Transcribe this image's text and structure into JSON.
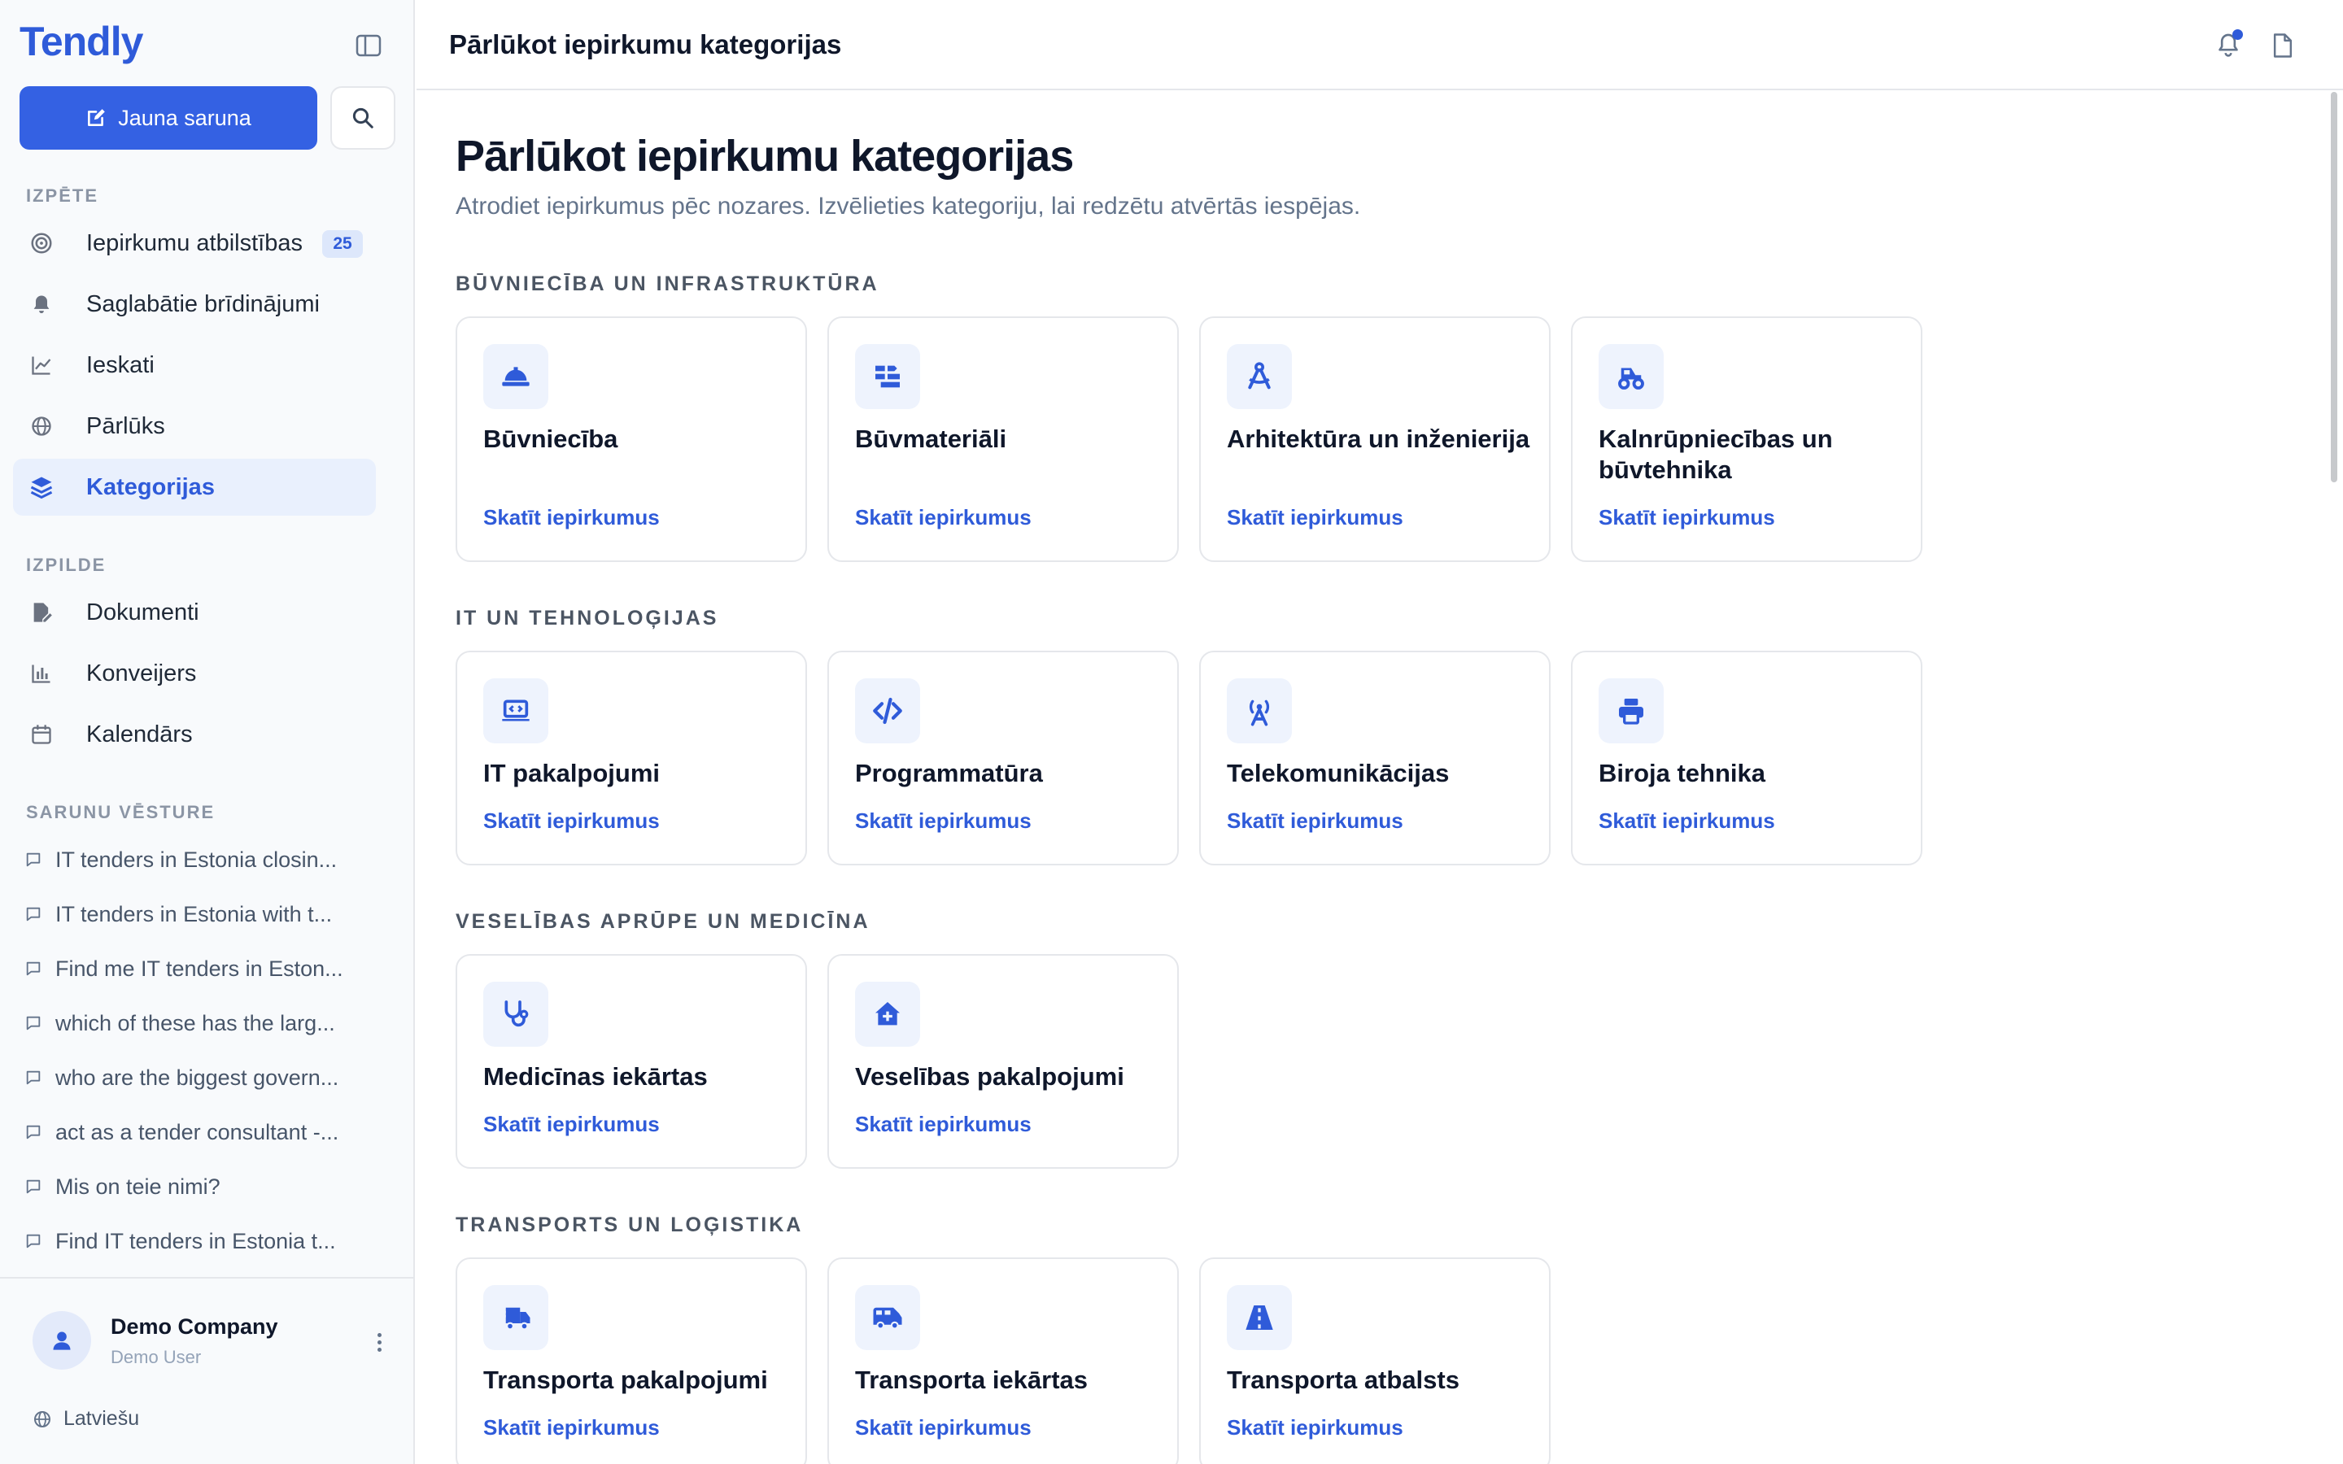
{
  "app": {
    "logo": "Tendly",
    "new_chat_label": "Jauna saruna"
  },
  "sidebar": {
    "section_explore": "IZPĒTE",
    "explore_items": [
      {
        "label": "Iepirkumu atbilstības",
        "icon": "target-icon",
        "badge": "25"
      },
      {
        "label": "Saglabātie brīdinājumi",
        "icon": "bell-icon"
      },
      {
        "label": "Ieskati",
        "icon": "line-chart-icon"
      },
      {
        "label": "Pārlūks",
        "icon": "globe-icon"
      },
      {
        "label": "Kategorijas",
        "icon": "layers-icon",
        "active": true
      }
    ],
    "section_execution": "IZPILDE",
    "execution_items": [
      {
        "label": "Dokumenti",
        "icon": "document-edit-icon"
      },
      {
        "label": "Konveijers",
        "icon": "bar-chart-icon"
      },
      {
        "label": "Kalendārs",
        "icon": "calendar-icon"
      }
    ],
    "section_history": "SARUNU VĒSTURE",
    "history": [
      "IT tenders in Estonia closin...",
      "IT tenders in Estonia with t...",
      "Find me IT tenders in Eston...",
      "which of these has the larg...",
      "who are the biggest govern...",
      "act as a tender consultant -...",
      "Mis on teie nimi?",
      "Find IT tenders in Estonia t..."
    ],
    "user": {
      "name": "Demo Company",
      "role": "Demo User"
    },
    "language": "Latviešu"
  },
  "topbar": {
    "title": "Pārlūkot iepirkumu kategorijas",
    "notification_dot": true
  },
  "main": {
    "title": "Pārlūkot iepirkumu kategorijas",
    "subtitle": "Atrodiet iepirkumus pēc nozares. Izvēlieties kategoriju, lai redzētu atvērtās iespējas.",
    "link_label": "Skatīt iepirkumus",
    "categories": [
      {
        "label": "BŪVNIECĪBA UN INFRASTRUKTŪRA",
        "items": [
          {
            "name": "Būvniecība",
            "icon": "hard-hat-icon"
          },
          {
            "name": "Būvmateriāli",
            "icon": "bricks-icon"
          },
          {
            "name": "Arhitektūra un inženierija",
            "icon": "compass-icon"
          },
          {
            "name": "Kalnrūpniecības un būvtehnika",
            "icon": "tractor-icon"
          }
        ]
      },
      {
        "label": "IT UN TEHNOLOĢIJAS",
        "items": [
          {
            "name": "IT pakalpojumi",
            "icon": "laptop-code-icon"
          },
          {
            "name": "Programmatūra",
            "icon": "code-icon"
          },
          {
            "name": "Telekomunikācijas",
            "icon": "tower-broadcast-icon"
          },
          {
            "name": "Biroja tehnika",
            "icon": "printer-icon"
          }
        ]
      },
      {
        "label": "VESELĪBAS APRŪPE UN MEDICĪNA",
        "items": [
          {
            "name": "Medicīnas iekārtas",
            "icon": "stethoscope-icon"
          },
          {
            "name": "Veselības pakalpojumi",
            "icon": "house-medical-icon"
          }
        ]
      },
      {
        "label": "TRANSPORTS UN LOĢISTIKA",
        "items": [
          {
            "name": "Transporta pakalpojumi",
            "icon": "truck-fast-icon"
          },
          {
            "name": "Transporta iekārtas",
            "icon": "van-icon"
          },
          {
            "name": "Transporta atbalsts",
            "icon": "road-icon"
          }
        ]
      }
    ]
  },
  "colors": {
    "accent": "#3461e3",
    "active_bg": "#e9f0fd",
    "icon_tile_bg": "#eef3fd",
    "border": "#e5e7eb"
  }
}
